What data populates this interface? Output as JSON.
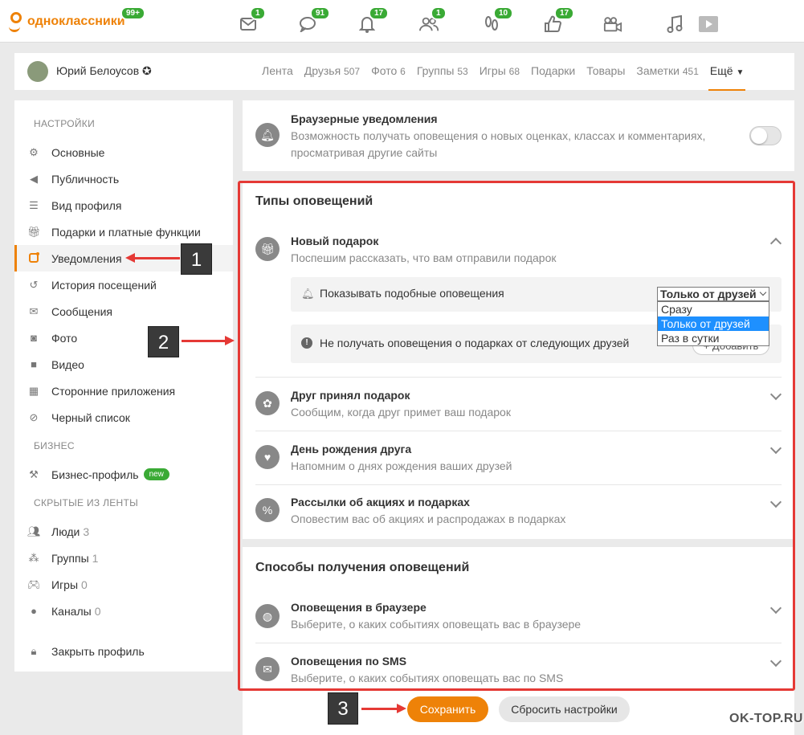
{
  "header": {
    "logo_text": "одноклассники",
    "logo_badge": "99+",
    "nav": [
      {
        "icon": "mail-icon",
        "count": "1"
      },
      {
        "icon": "chat-icon",
        "count": "91"
      },
      {
        "icon": "bell-icon",
        "count": "17"
      },
      {
        "icon": "friends-icon",
        "count": "1"
      },
      {
        "icon": "footprints-icon",
        "count": "10"
      },
      {
        "icon": "like-icon",
        "count": "17"
      },
      {
        "icon": "video-camera-icon",
        "count": ""
      },
      {
        "icon": "music-icon",
        "count": ""
      },
      {
        "icon": "play-icon",
        "count": ""
      }
    ],
    "accent_color": "#ee8208",
    "badge_color": "#3aaa35"
  },
  "profile": {
    "name": "Юрий Белоусов ✪",
    "tabs": [
      {
        "label": "Лента",
        "num": ""
      },
      {
        "label": "Друзья",
        "num": "507"
      },
      {
        "label": "Фото",
        "num": "6"
      },
      {
        "label": "Группы",
        "num": "53"
      },
      {
        "label": "Игры",
        "num": "68"
      },
      {
        "label": "Подарки",
        "num": ""
      },
      {
        "label": "Товары",
        "num": ""
      },
      {
        "label": "Заметки",
        "num": "451"
      }
    ],
    "more_label": "Ещё"
  },
  "sidebar": {
    "settings_heading": "НАСТРОЙКИ",
    "settings_items": [
      {
        "icon": "gear-icon",
        "label": "Основные"
      },
      {
        "icon": "megaphone-icon",
        "label": "Публичность"
      },
      {
        "icon": "profile-view-icon",
        "label": "Вид профиля"
      },
      {
        "icon": "gift-icon",
        "label": "Подарки и платные функции"
      },
      {
        "icon": "notification-icon",
        "label": "Уведомления"
      },
      {
        "icon": "history-icon",
        "label": "История посещений"
      },
      {
        "icon": "envelope-icon",
        "label": "Сообщения"
      },
      {
        "icon": "camera-icon",
        "label": "Фото"
      },
      {
        "icon": "video-icon",
        "label": "Видео"
      },
      {
        "icon": "apps-icon",
        "label": "Сторонние приложения"
      },
      {
        "icon": "blacklist-icon",
        "label": "Черный список"
      }
    ],
    "business_heading": "БИЗНЕС",
    "business_item": "Бизнес-профиль",
    "new_badge": "new",
    "hidden_heading": "СКРЫТЫЕ ИЗ ЛЕНТЫ",
    "hidden_items": [
      {
        "icon": "people-icon",
        "label": "Люди",
        "count": "3"
      },
      {
        "icon": "groups-icon",
        "label": "Группы",
        "count": "1"
      },
      {
        "icon": "gamepad-icon",
        "label": "Игры",
        "count": "0"
      },
      {
        "icon": "channels-icon",
        "label": "Каналы",
        "count": "0"
      }
    ],
    "close_profile": "Закрыть профиль"
  },
  "browser_notif": {
    "title": "Браузерные уведомления",
    "desc_line1": "Возможность получать оповещения о новых оценках, классах и комментариях,",
    "desc_line2": "просматривая другие сайты"
  },
  "types": {
    "heading": "Типы оповещений",
    "gift": {
      "title": "Новый подарок",
      "desc": "Поспешим рассказать, что вам отправили подарок",
      "show_label": "Показывать подобные оповещения",
      "select_value": "Только от друзей",
      "options": [
        "Сразу",
        "Только от друзей",
        "Раз в сутки"
      ],
      "exclude_label": "Не получать оповещения о подарках от следующих друзей",
      "add_label": "+ Добавить"
    },
    "items": [
      {
        "icon": "gift-accept-icon",
        "title": "Друг принял подарок",
        "desc": "Сообщим, когда друг примет ваш подарок"
      },
      {
        "icon": "balloons-icon",
        "title": "День рождения друга",
        "desc": "Напомним о днях рождения ваших друзей"
      },
      {
        "icon": "percent-icon",
        "title": "Рассылки об акциях и подарках",
        "desc": "Оповестим вас об акциях и распродажах в подарках"
      }
    ]
  },
  "methods": {
    "heading": "Способы получения оповещений",
    "items": [
      {
        "icon": "globe-icon",
        "title": "Оповещения в браузере",
        "desc": "Выберите, о каких событиях оповещать вас в браузере"
      },
      {
        "icon": "sms-icon",
        "title": "Оповещения по SMS",
        "desc": "Выберите, о каких событиях оповещать вас по SMS"
      }
    ]
  },
  "actions": {
    "save": "Сохранить",
    "reset": "Сбросить настройки"
  },
  "annotations": {
    "n1": "1",
    "n2": "2",
    "n3": "3",
    "color": "#e53935"
  },
  "watermark": "OK-TOP.RU"
}
